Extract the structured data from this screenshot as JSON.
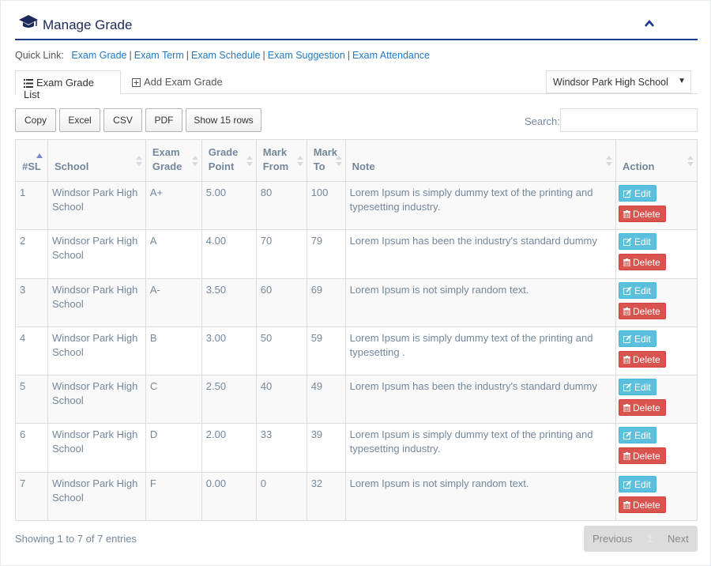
{
  "panel": {
    "title": "Manage Grade",
    "icon": "graduation-cap-icon",
    "collapse_icon": "chevron-up-icon",
    "accent_color": "#1a3a8a"
  },
  "quick_links": {
    "label": "Quick Link:",
    "items": [
      "Exam Grade",
      "Exam Term",
      "Exam Schedule",
      "Exam Suggestion",
      "Exam Attendance"
    ],
    "separator": "|"
  },
  "tabs": {
    "list_label": "Exam Grade List",
    "add_label": "Add Exam Grade"
  },
  "school_select": {
    "selected": "Windsor Park High School",
    "caret": "▼"
  },
  "toolbar": {
    "buttons": [
      "Copy",
      "Excel",
      "CSV",
      "PDF",
      "Show 15 rows"
    ],
    "search_label": "Search:"
  },
  "table": {
    "headers": {
      "sl": "#SL",
      "school": "School",
      "exam_grade_1": "Exam",
      "exam_grade_2": "Grade",
      "grade_point_1": "Grade",
      "grade_point_2": "Point",
      "mark_from_1": "Mark",
      "mark_from_2": "From",
      "mark_to_1": "Mark",
      "mark_to_2": "To",
      "note": "Note",
      "action": "Action"
    },
    "edit_label": "Edit",
    "delete_label": "Delete",
    "rows": [
      {
        "sl": "1",
        "school_1": "Windsor Park High",
        "school_2": "School",
        "grade": "A+",
        "point": "5.00",
        "from": "80",
        "to": "100",
        "note_1": "Lorem Ipsum is simply dummy text of the printing and",
        "note_2": "typesetting industry."
      },
      {
        "sl": "2",
        "school_1": "Windsor Park High",
        "school_2": "School",
        "grade": "A",
        "point": "4.00",
        "from": "70",
        "to": "79",
        "note_1": "Lorem Ipsum has been the industry's standard dummy",
        "note_2": ""
      },
      {
        "sl": "3",
        "school_1": "Windsor Park High",
        "school_2": "School",
        "grade": "A-",
        "point": "3.50",
        "from": "60",
        "to": "69",
        "note_1": "Lorem Ipsum is not simply random text.",
        "note_2": ""
      },
      {
        "sl": "4",
        "school_1": "Windsor Park High",
        "school_2": "School",
        "grade": "B",
        "point": "3.00",
        "from": "50",
        "to": "59",
        "note_1": "Lorem Ipsum is simply dummy text of the printing and",
        "note_2": "typesetting ."
      },
      {
        "sl": "5",
        "school_1": "Windsor Park High",
        "school_2": "School",
        "grade": "C",
        "point": "2.50",
        "from": "40",
        "to": "49",
        "note_1": "Lorem Ipsum has been the industry's standard dummy",
        "note_2": ""
      },
      {
        "sl": "6",
        "school_1": "Windsor Park High",
        "school_2": "School",
        "grade": "D",
        "point": "2.00",
        "from": "33",
        "to": "39",
        "note_1": "Lorem Ipsum is simply dummy text of the printing and",
        "note_2": "typesetting industry."
      },
      {
        "sl": "7",
        "school_1": "Windsor Park High",
        "school_2": "School",
        "grade": "F",
        "point": "0.00",
        "from": "0",
        "to": "32",
        "note_1": "Lorem Ipsum is not simply random text.",
        "note_2": ""
      }
    ]
  },
  "footer": {
    "info": "Showing 1 to 7 of 7 entries",
    "previous": "Previous",
    "page": "1",
    "next": "Next"
  },
  "colors": {
    "link": "#1f7ac7",
    "edit": "#5bc0de",
    "delete": "#d9534f",
    "text": "#73879c"
  }
}
